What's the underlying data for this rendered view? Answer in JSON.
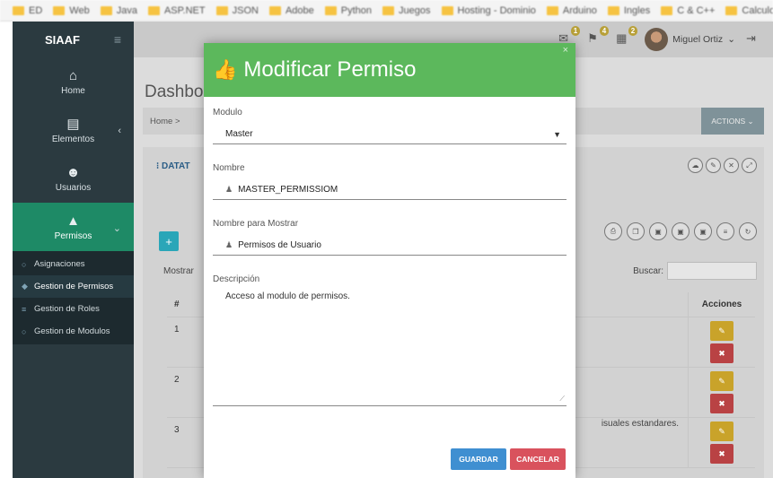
{
  "bookmarks": [
    "ED",
    "Web",
    "Java",
    "ASP.NET",
    "JSON",
    "Adobe",
    "Python",
    "Juegos",
    "Hosting - Dominio",
    "Arduino",
    "Ingles",
    "C & C++",
    "Calculo"
  ],
  "sidebar": {
    "brand": "SIAAF",
    "items": [
      {
        "label": "Home",
        "icon": "home-icon"
      },
      {
        "label": "Elementos",
        "icon": "book-icon"
      },
      {
        "label": "Usuarios",
        "icon": "users-icon"
      },
      {
        "label": "Permisos",
        "icon": "lock-icon"
      }
    ],
    "subitems": [
      "Asignaciones",
      "Gestion de Permisos",
      "Gestion de Roles",
      "Gestion de Modulos"
    ]
  },
  "topbar": {
    "badges": [
      "1",
      "4",
      "2"
    ],
    "user": "Miguel Ortiz"
  },
  "page": {
    "title": "Dashboa",
    "breadcrumb": "Home >",
    "actions": "ACTIONS ⌄",
    "panel_title": "DATAT",
    "mostrar": "Mostrar",
    "buscar": "Buscar:",
    "col_hash": "#",
    "col_acciones": "Acciones",
    "rows": [
      "1",
      "2",
      "3"
    ],
    "partial_text": "isuales estandares."
  },
  "modal": {
    "title": "Modificar Permiso",
    "modulo_label": "Modulo",
    "modulo_value": "Master",
    "nombre_label": "Nombre",
    "nombre_value": "MASTER_PERMISSIOM",
    "mostrar_label": "Nombre para Mostrar",
    "mostrar_value": "Permisos de Usuario",
    "desc_label": "Descripción",
    "desc_value": "Acceso al modulo de permisos.",
    "guardar": "GUARDAR",
    "cancelar": "CANCELAR"
  }
}
